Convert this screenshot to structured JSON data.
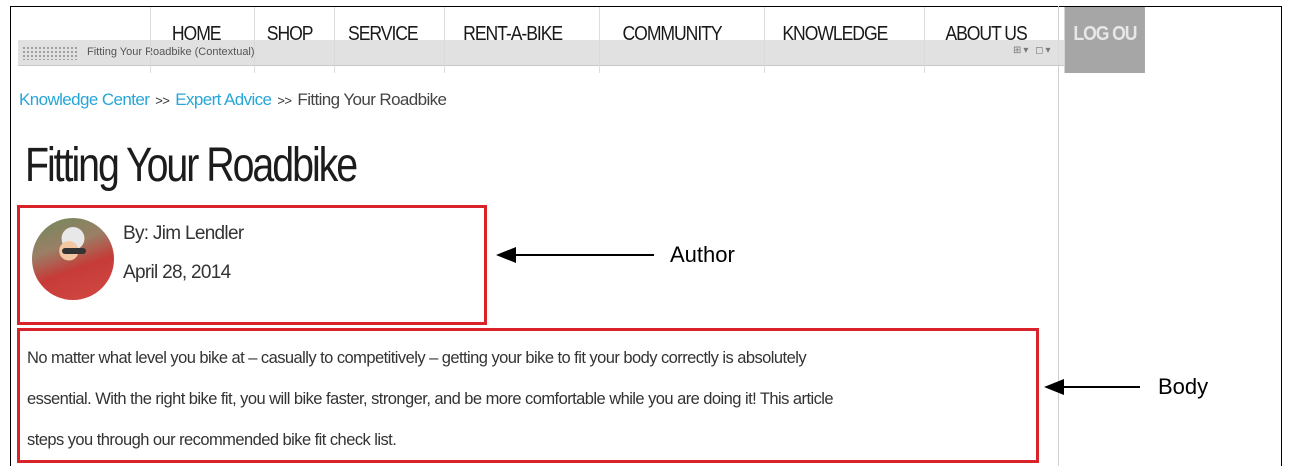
{
  "nav": {
    "items": [
      {
        "label": "HOME"
      },
      {
        "label": "SHOP"
      },
      {
        "label": "SERVICE"
      },
      {
        "label": "RENT-A-BIKE"
      },
      {
        "label": "COMMUNITY"
      },
      {
        "label": "KNOWLEDGE"
      },
      {
        "label": "ABOUT US"
      },
      {
        "label": "LOG OU"
      }
    ]
  },
  "context_toolbar": {
    "label": "Fitting Your Roadbike (Contextual)",
    "icons": "⊞▾ ◻▾"
  },
  "breadcrumb": {
    "items": [
      "Knowledge Center",
      "Expert Advice",
      "Fitting Your Roadbike"
    ],
    "separator": ">>"
  },
  "article": {
    "title": "Fitting Your Roadbike",
    "author": "By: Jim Lendler",
    "date": "April 28, 2014",
    "body_lines": [
      "No matter what level you bike at – casually to competitively – getting your bike to fit your body correctly is absolutely",
      "essential. With the right bike fit, you will bike faster, stronger, and be more comfortable while you are doing it! This article",
      "steps you through our recommended bike fit check list."
    ]
  },
  "annotations": {
    "author_label": "Author",
    "body_label": "Body"
  },
  "colors": {
    "link": "#27a6d8",
    "highlight_box": "#d9232b",
    "logout_bg": "#a6a6a6"
  }
}
